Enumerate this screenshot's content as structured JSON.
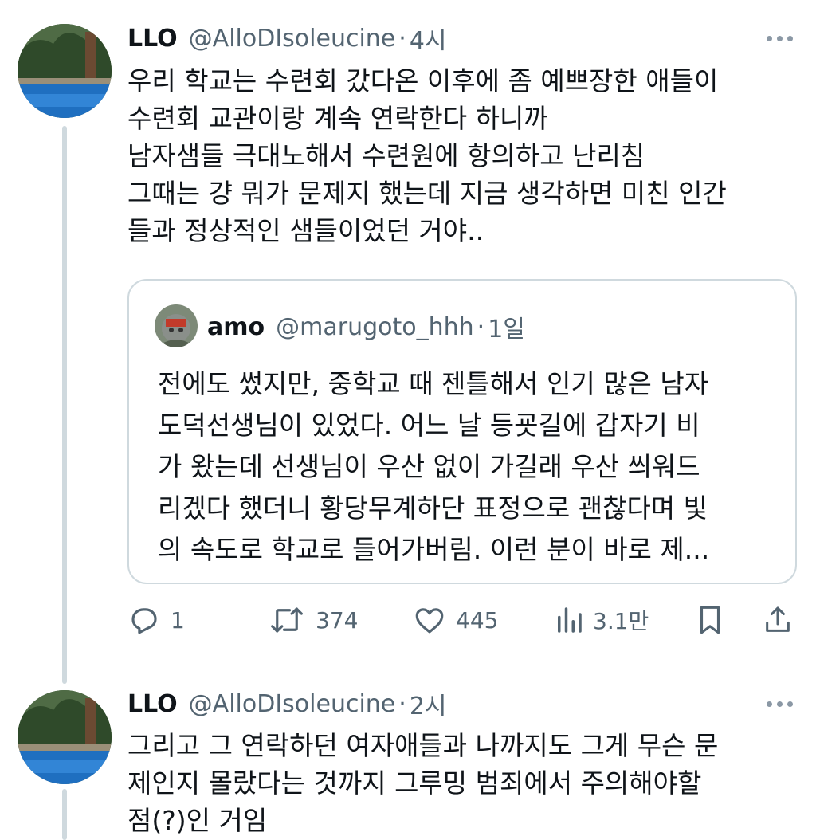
{
  "tweets": [
    {
      "display_name": "LLO",
      "handle": "@AlloDIsoleucine",
      "separator": "·",
      "time": "4시",
      "lines": [
        "우리 학교는 수련회 갔다온 이후에 좀 예쁘장한 애들이",
        "수련회 교관이랑 계속 연락한다 하니까",
        "남자샘들 극대노해서 수련원에 항의하고 난리침",
        "그때는 걍 뭐가 문제지 했는데 지금 생각하면 미친 인간",
        "들과 정상적인 샘들이었던 거야.."
      ],
      "quote": {
        "display_name": "amo",
        "handle": "@marugoto_hhh",
        "separator": "·",
        "time": "1일",
        "lines": [
          "전에도 썼지만, 중학교 때 젠틀해서 인기 많은 남자",
          "도덕선생님이 있었다. 어느 날 등굣길에 갑자기 비",
          "가 왔는데 선생님이 우산 없이 가길래 우산 씌워드",
          "리겠다 했더니 황당무계하단 표정으로 괜찮다며 빛",
          "의 속도로 학교로 들어가버림. 이런 분이 바로 제..."
        ]
      },
      "actions": {
        "reply_count": "1",
        "retweet_count": "374",
        "like_count": "445",
        "view_count": "3.1만"
      }
    },
    {
      "display_name": "LLO",
      "handle": "@AlloDIsoleucine",
      "separator": "·",
      "time": "2시",
      "lines": [
        "그리고 그 연락하던 여자애들과 나까지도 그게 무슨 문",
        "제인지 몰랐다는 것까지 그루밍 범죄에서 주의해야할",
        "점(?)인 거임"
      ]
    }
  ],
  "colors": {
    "text": "#0f1419",
    "secondary": "#536471",
    "border": "#cfd9de"
  }
}
